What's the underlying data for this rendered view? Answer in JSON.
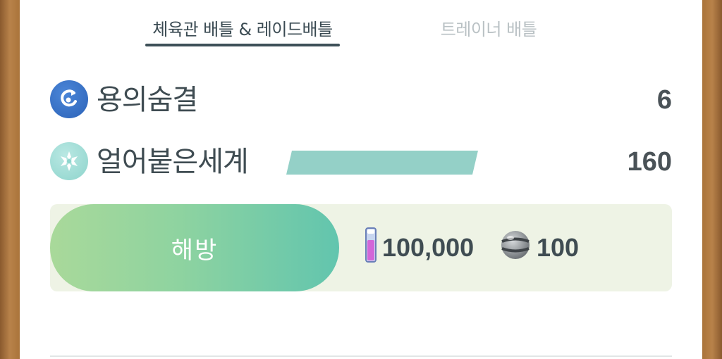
{
  "tabs": [
    {
      "label": "체육관 배틀 & 레이드배틀",
      "active": true
    },
    {
      "label": "트레이너 배틀",
      "active": false
    }
  ],
  "moves": [
    {
      "name": "용의숨결",
      "type_icon": "dragon-type-icon",
      "type_color": "#2c63b8",
      "value": "6"
    },
    {
      "name": "얼어붙은세계",
      "type_icon": "ice-type-icon",
      "type_color": "#8ed4cc",
      "value": "160",
      "charge_fraction": 1.0
    }
  ],
  "unlock": {
    "button_label": "해방",
    "stardust_icon": "stardust-icon",
    "stardust_cost": "100,000",
    "candy_icon": "candy-icon",
    "candy_cost": "100"
  },
  "colors": {
    "accent_button_start": "#a9d99a",
    "accent_button_end": "#62c5ae",
    "charge_bar": "#94d0c7"
  }
}
